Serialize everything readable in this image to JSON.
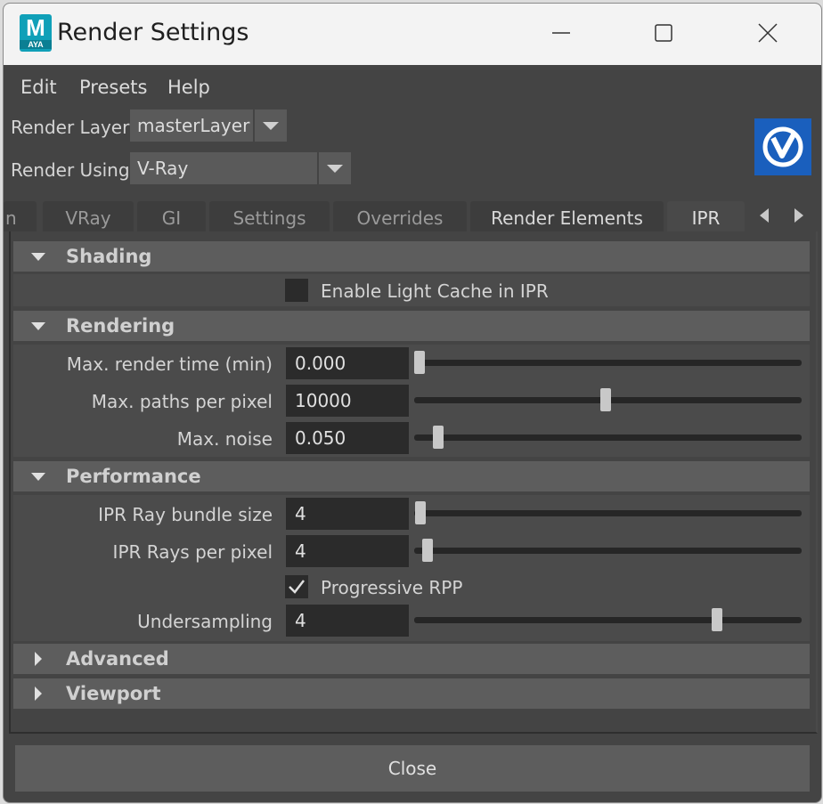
{
  "window": {
    "app_icon_letter": "M",
    "app_icon_sub": "AYA",
    "title": "Render Settings",
    "controls": [
      "minimize-icon",
      "maximize-icon",
      "close-icon"
    ]
  },
  "menu": [
    "Edit",
    "Presets",
    "Help"
  ],
  "render_layer": {
    "label": "Render Layer",
    "value": "masterLayer"
  },
  "render_using": {
    "label": "Render Using",
    "value": "V-Ray"
  },
  "tabs": {
    "partial": "n",
    "items": [
      "VRay",
      "GI",
      "Settings",
      "Overrides",
      "Render Elements",
      "IPR"
    ],
    "active": "IPR"
  },
  "sections": {
    "shading": {
      "title": "Shading",
      "enable_light_cache": {
        "label": "Enable Light Cache in IPR",
        "checked": false
      }
    },
    "rendering": {
      "title": "Rendering",
      "max_render_time": {
        "label": "Max. render time (min)",
        "value": "0.000",
        "slider": 0.0
      },
      "max_paths": {
        "label": "Max. paths per pixel",
        "value": "10000",
        "slider": 0.5
      },
      "max_noise": {
        "label": "Max. noise",
        "value": "0.050",
        "slider": 0.05
      }
    },
    "performance": {
      "title": "Performance",
      "bundle_size": {
        "label": "IPR Ray bundle size",
        "value": "4",
        "slider": 0.0
      },
      "rays_per_pixel": {
        "label": "IPR Rays per pixel",
        "value": "4",
        "slider": 0.03
      },
      "progressive_rpp": {
        "label": "Progressive RPP",
        "checked": true
      },
      "undersampling": {
        "label": "Undersampling",
        "value": "4",
        "slider": 0.78
      }
    },
    "advanced": {
      "title": "Advanced"
    },
    "viewport": {
      "title": "Viewport"
    }
  },
  "close_button": "Close",
  "colors": {
    "accent_vray": "#1a5fbd",
    "maya_icon": "#10a0b8",
    "panel_bg": "#444444"
  }
}
